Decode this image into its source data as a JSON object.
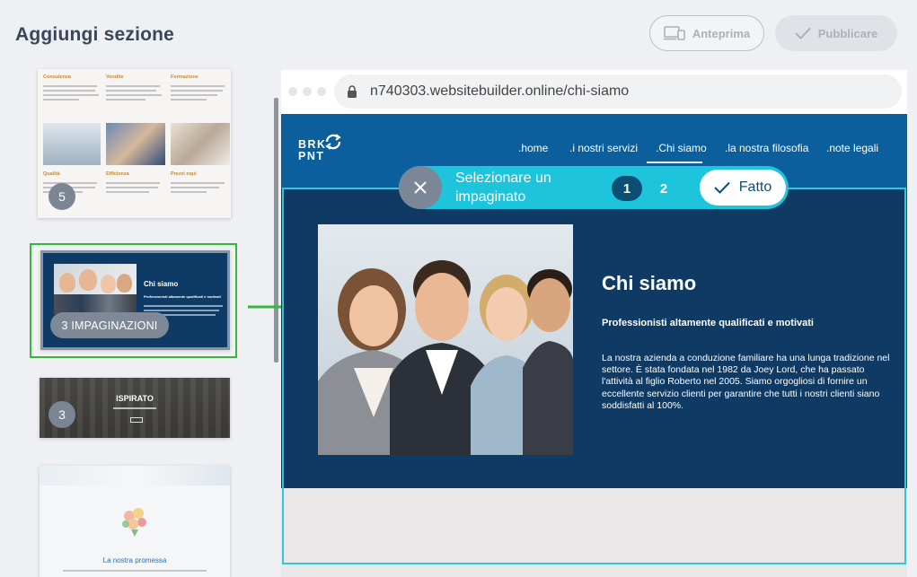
{
  "panel": {
    "title": "Aggiungi sezione"
  },
  "toolbar": {
    "preview_label": "Anteprima",
    "publish_label": "Pubblicare",
    "preview_icon": "devices-icon",
    "publish_icon": "check-icon"
  },
  "thumbnails": [
    {
      "badge": "5",
      "columns": [
        "Consulenza",
        "Vendite",
        "Formazione"
      ],
      "columns_row2": [
        "Qualità",
        "Efficienza",
        "Prezzi equi"
      ]
    },
    {
      "title": "Chi siamo",
      "subtitle": "Professionisti altamente qualificati e motivati",
      "layouts_label": "3 IMPAGINAZIONI",
      "selected": true
    },
    {
      "badge": "3",
      "title": "ISPIRATO"
    },
    {
      "title": "La nostra promessa"
    }
  ],
  "browser": {
    "url": "n740303.websitebuilder.online/chi-siamo"
  },
  "site": {
    "logo_line1": "BRK",
    "logo_line2": "PNT",
    "nav": [
      ".home",
      ".i nostri servizi",
      ".Chi siamo",
      ".la nostra filosofia",
      ".note legali"
    ],
    "active_nav": ".Chi siamo",
    "section_title": "Chi siamo",
    "section_subtitle": "Professionisti altamente qualificati e motivati",
    "section_body": "La nostra azienda a conduzione familiare ha una lunga tradizione nel settore. È stata fondata nel 1982 da Joey Lord, che ha passato l'attività al figlio Roberto nel 2005. Siamo orgogliosi di fornire un eccellente servizio clienti per garantire che tutti i nostri clienti siano soddisfatti al 100%."
  },
  "layout_selector": {
    "label": "Selezionare un impaginato",
    "options": [
      "1",
      "2"
    ],
    "active": "1",
    "done_label": "Fatto"
  },
  "colors": {
    "accent": "#1ec4dc",
    "nav_blue": "#0b5f9d",
    "section_navy": "#0e3a63",
    "selected_green": "#35b83c"
  }
}
